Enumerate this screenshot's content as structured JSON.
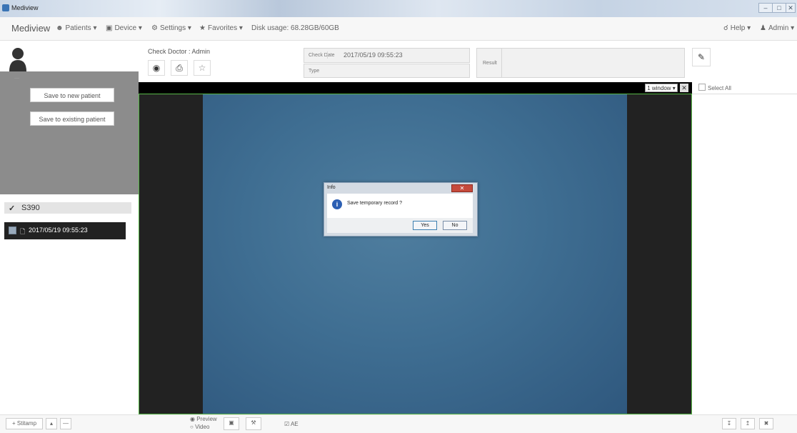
{
  "window": {
    "title": "Mediview",
    "controls": [
      "–",
      "□",
      "✕"
    ]
  },
  "menubar": {
    "brand": "Mediview",
    "patients": "Patients",
    "device": "Device",
    "settings": "Settings",
    "favorites": "Favorites",
    "disk_usage": "Disk usage: 68.28GB/60GB",
    "help": "Help",
    "admin": "Admin",
    "caret": "▾"
  },
  "left": {
    "save_new": "Save to new patient",
    "save_existing": "Save to existing patient",
    "group_name": "S390",
    "group_chevron": "✓",
    "record_label": "2017/05/19 09:55:23"
  },
  "check": {
    "doctor_label": "Check Doctor : Admin",
    "date_label": "Check Date",
    "date_value": "2017/05/19 09:55:23",
    "type_label": "Type",
    "result_label": "Result"
  },
  "view": {
    "window_select": "1 window ▾",
    "expand": "✕"
  },
  "dialog": {
    "title": "Info",
    "close": "✕",
    "message": "Save temporary record ?",
    "yes": "Yes",
    "no": "No"
  },
  "right": {
    "select_all": "Select All"
  },
  "bottom": {
    "stitamp": "Stitamp",
    "preview": "Preview",
    "video": "Video",
    "ae": "AE"
  }
}
